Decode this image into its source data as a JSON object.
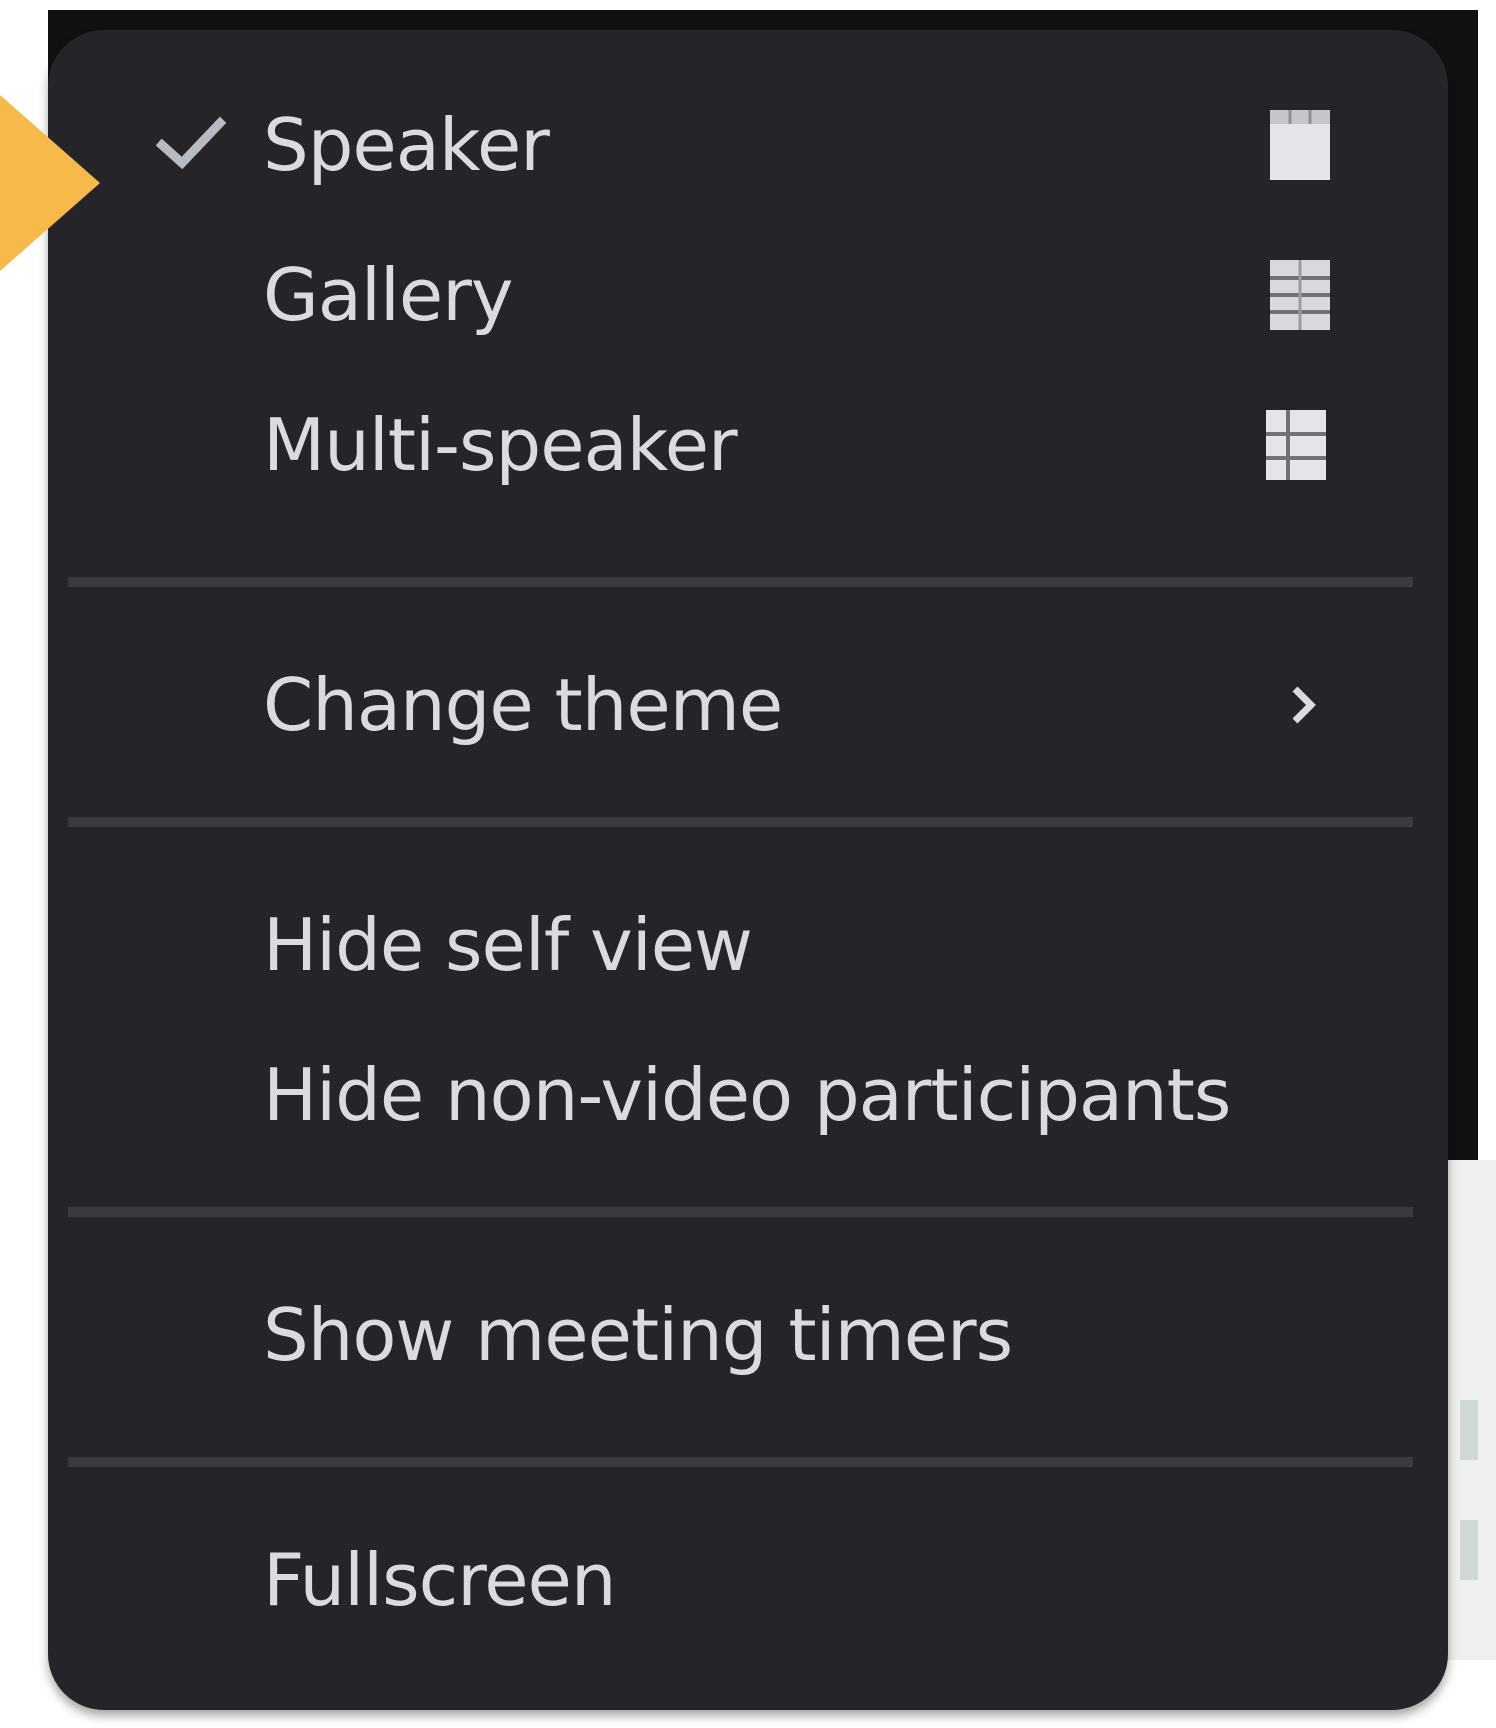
{
  "menu": {
    "view_modes": [
      {
        "label": "Speaker",
        "checked": true,
        "icon": "speaker-layout-icon"
      },
      {
        "label": "Gallery",
        "checked": false,
        "icon": "gallery-layout-icon"
      },
      {
        "label": "Multi-speaker",
        "checked": false,
        "icon": "multi-speaker-layout-icon"
      }
    ],
    "change_theme": {
      "label": "Change theme",
      "icon": "chevron-right-icon"
    },
    "visibility": [
      {
        "label": "Hide self view"
      },
      {
        "label": "Hide non-video participants"
      }
    ],
    "show_meeting_timers": {
      "label": "Show meeting timers"
    },
    "fullscreen": {
      "label": "Fullscreen"
    }
  },
  "colors": {
    "menu_background": "#252529",
    "text": "#d9dbe0",
    "divider": "#3a3b40",
    "annotation_arrow": "#f6b94a"
  }
}
